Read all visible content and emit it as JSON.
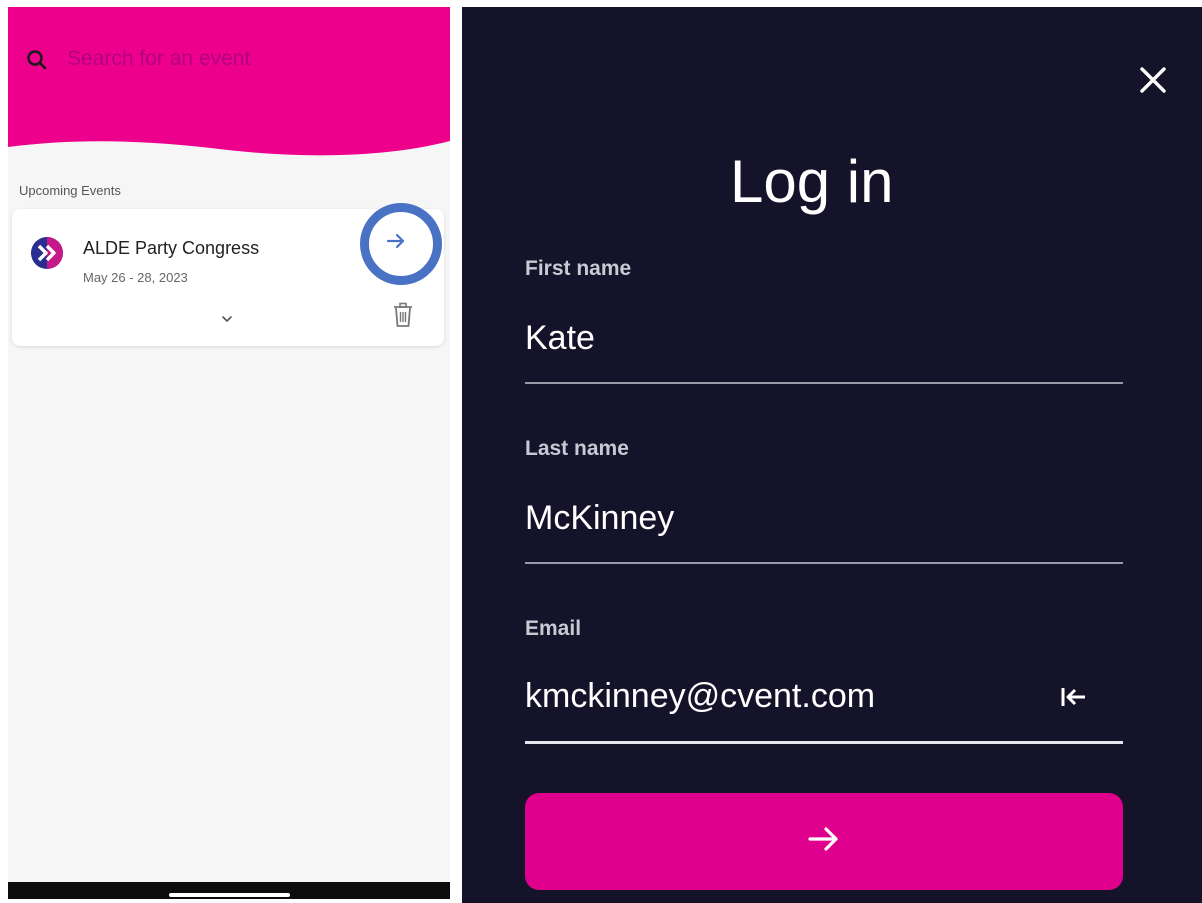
{
  "left": {
    "search": {
      "placeholder": "Search for an event",
      "icon": "search-icon"
    },
    "section_label": "Upcoming Events",
    "events": [
      {
        "title": "ALDE Party Congress",
        "date": "May 26 - 28, 2023",
        "logo": "alde-logo"
      }
    ],
    "colors": {
      "header": "#ec008c",
      "search_text": "#b2007e",
      "highlight_ring": "#4a72c4",
      "arrow": "#4a72c4"
    }
  },
  "right": {
    "title": "Log in",
    "fields": [
      {
        "label": "First name",
        "value": "Kate"
      },
      {
        "label": "Last name",
        "value": "McKinney"
      },
      {
        "label": "Email",
        "value": "kmckinney@cvent.com"
      }
    ],
    "colors": {
      "background": "#14132a",
      "button": "#e0008e"
    }
  }
}
